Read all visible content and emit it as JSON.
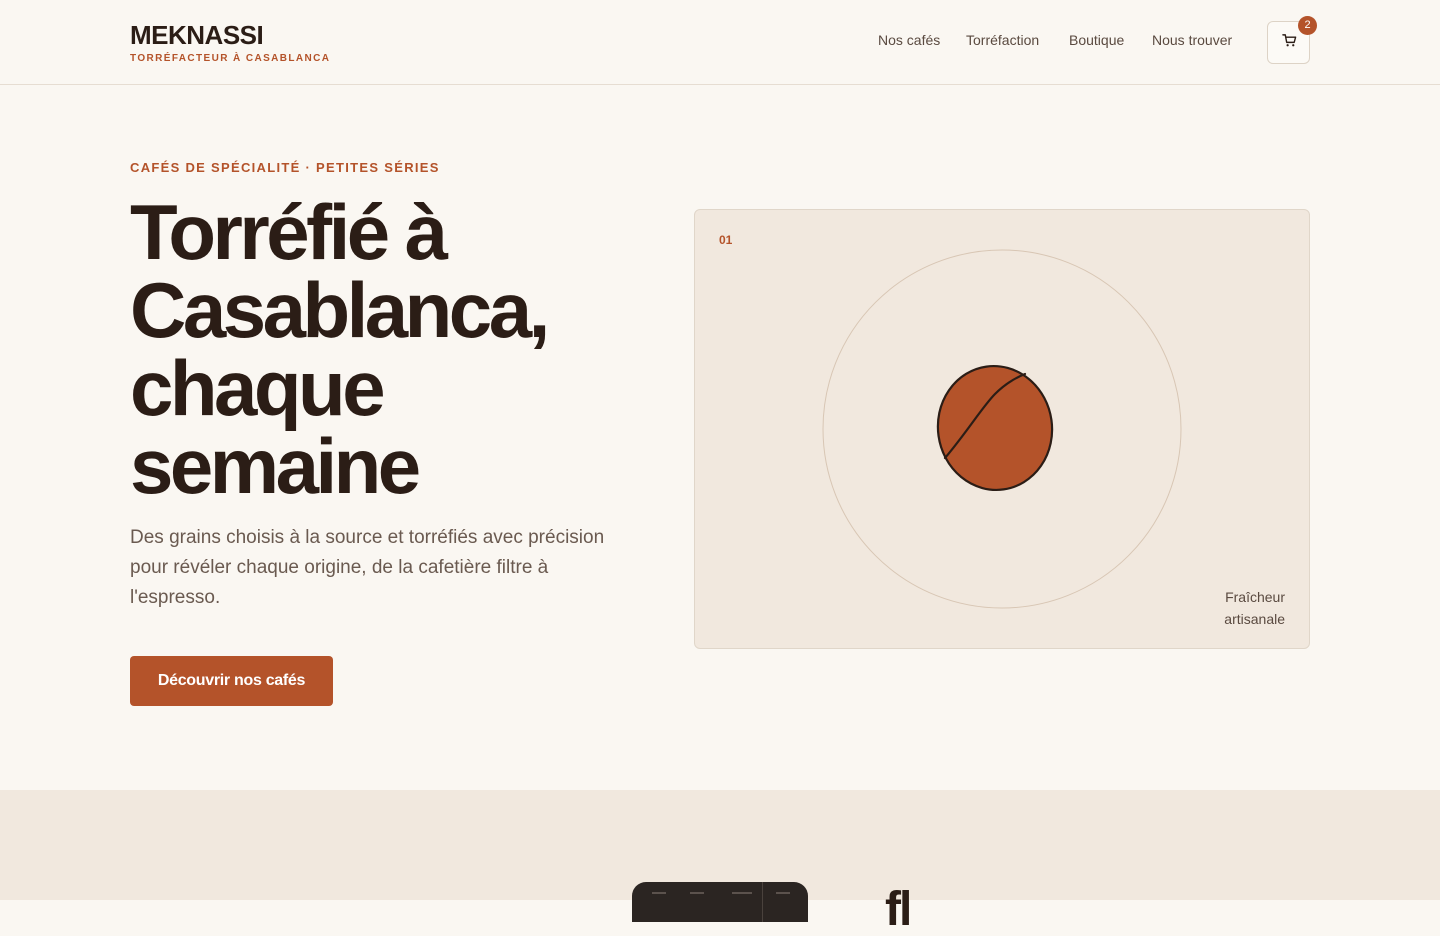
{
  "header": {
    "brand": "MEKNASSI",
    "tagline": "TORRÉFACTEUR À CASABLANCA",
    "nav": [
      "Nos cafés",
      "Torréfaction",
      "Boutique",
      "Nous trouver"
    ],
    "cart_count": "2",
    "cart_icon": "shopping-cart-icon"
  },
  "hero": {
    "eyebrow": "CAFÉS DE SPÉCIALITÉ · PETITES SÉRIES",
    "headline": "Torréfié à Casablanca, chaque semaine",
    "lede": "Des grains choisis à la source et torréfiés avec précision pour révéler chaque origine, de la cafetière filtre à l'espresso.",
    "cta_label": "Découvrir nos cafés"
  },
  "visual": {
    "index": "01",
    "caption": "Fraîcheur artisanale",
    "icon": "coffee-bean-icon"
  },
  "section2": {
    "title": "fl"
  },
  "colors": {
    "accent": "#b4532a",
    "text_dark": "#2b1d16",
    "background": "#faf7f2",
    "panel": "#f1e8de"
  }
}
